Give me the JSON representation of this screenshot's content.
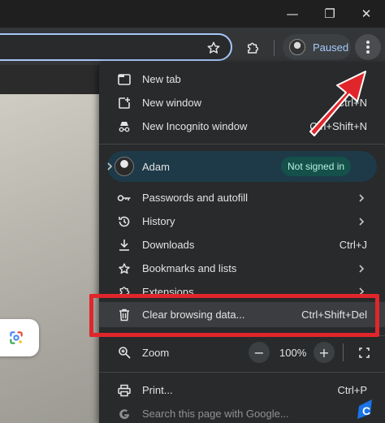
{
  "window": {
    "minimize_glyph": "—",
    "maximize_glyph": "❐",
    "close_glyph": "✕"
  },
  "toolbar": {
    "profile_status": "Paused",
    "icons": [
      "star-icon",
      "extensions-icon",
      "kebab-menu-icon"
    ]
  },
  "menu": {
    "top_items": [
      {
        "label": "New tab",
        "shortcut": "",
        "icon": "new-tab-icon"
      },
      {
        "label": "New window",
        "shortcut": "Ctrl+N",
        "icon": "new-window-icon"
      },
      {
        "label": "New Incognito window",
        "shortcut": "Ctrl+Shift+N",
        "icon": "incognito-icon"
      }
    ],
    "profile": {
      "name": "Adam",
      "status": "Not signed in"
    },
    "items": [
      {
        "label": "Passwords and autofill",
        "icon": "key-icon",
        "submenu": true
      },
      {
        "label": "History",
        "icon": "history-icon",
        "submenu": true
      },
      {
        "label": "Downloads",
        "shortcut": "Ctrl+J",
        "icon": "download-icon"
      },
      {
        "label": "Bookmarks and lists",
        "icon": "star-icon",
        "submenu": true
      },
      {
        "label": "Extensions",
        "icon": "extension-icon",
        "submenu": true
      },
      {
        "label": "Clear browsing data...",
        "shortcut": "Ctrl+Shift+Del",
        "icon": "trash-icon"
      }
    ],
    "zoom": {
      "label": "Zoom",
      "value": "100%",
      "minus": "−",
      "plus": "+"
    },
    "bottom_items": [
      {
        "label": "Print...",
        "shortcut": "Ctrl+P",
        "icon": "print-icon"
      },
      {
        "label": "Search this page with Google...",
        "icon": "google-icon"
      }
    ]
  },
  "colors": {
    "menu_bg": "#282a2c",
    "accent_blue": "#a8c7fa",
    "highlight_red": "#e0262b",
    "badge_bg": "#15504a"
  }
}
